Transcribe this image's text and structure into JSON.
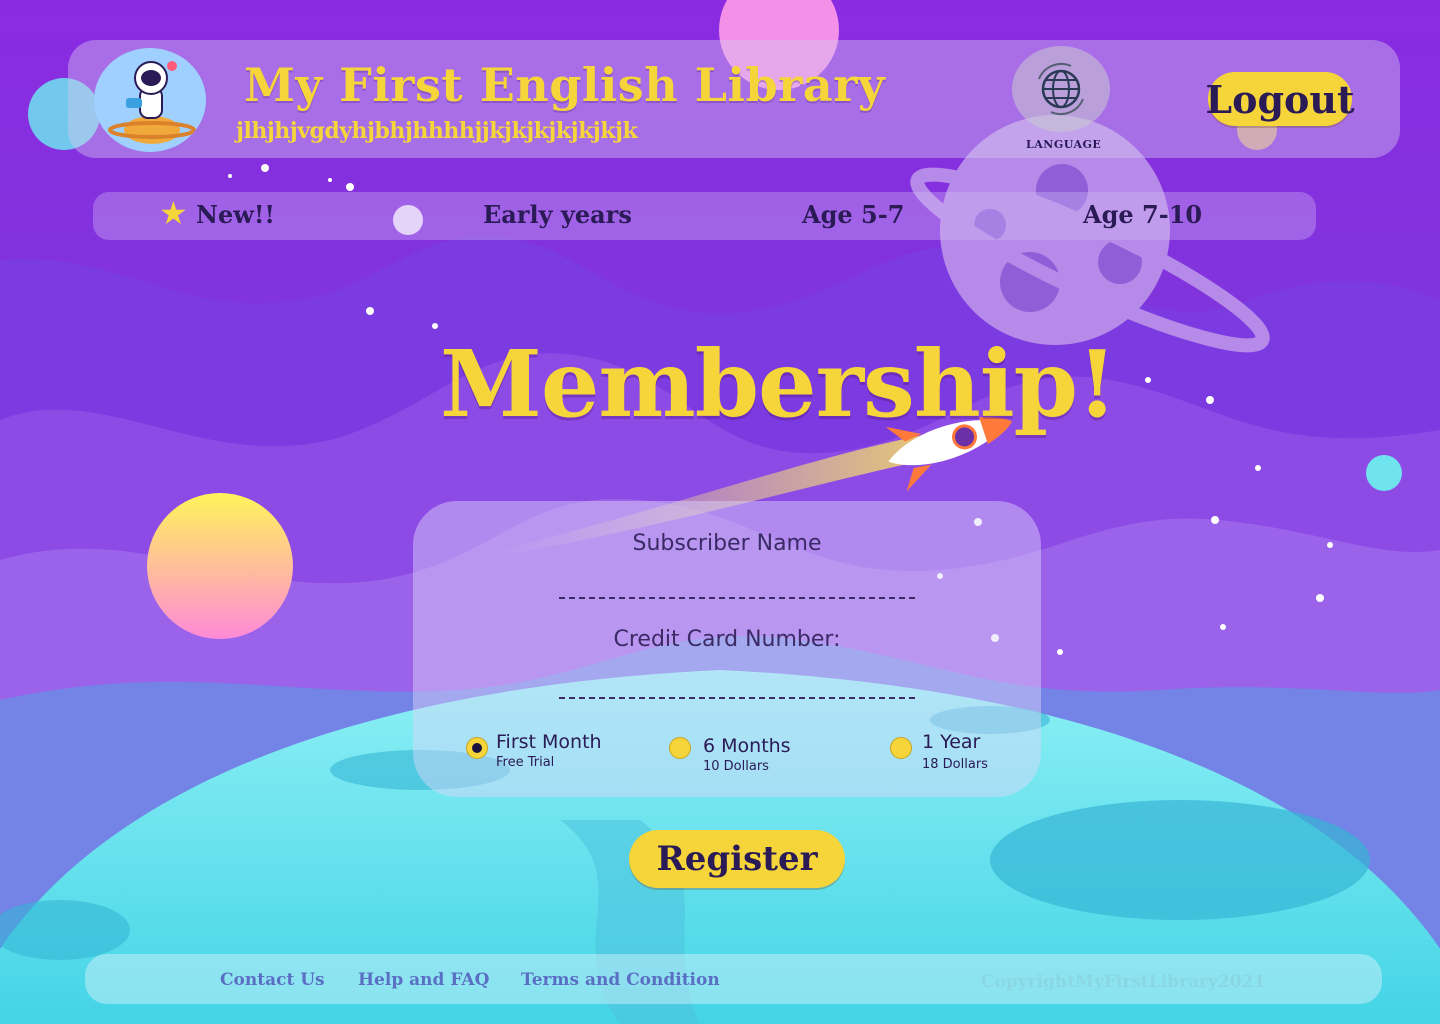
{
  "header": {
    "title": "My First English Library",
    "subtitle": "jlhjhjvgdyhjbhjhhhhjjkjkjkjkjkjkjk",
    "language_label": "LANGUAGE",
    "logout_label": "Logout"
  },
  "nav": {
    "items": [
      {
        "label": "New!!"
      },
      {
        "label": "Early years"
      },
      {
        "label": "Age 5-7"
      },
      {
        "label": "Age 7-10"
      }
    ]
  },
  "main": {
    "title": "Membership!",
    "form": {
      "name_label": "Subscriber Name",
      "name_value": "",
      "card_label": "Credit Card Number:",
      "card_value": "",
      "plans": [
        {
          "name": "First Month",
          "desc": "Free Trial",
          "selected": true
        },
        {
          "name": "6 Months",
          "desc": "10 Dollars",
          "selected": false
        },
        {
          "name": "1 Year",
          "desc": "18 Dollars",
          "selected": false
        }
      ]
    },
    "register_label": "Register"
  },
  "footer": {
    "links": [
      "Contact Us",
      "Help and FAQ",
      "Terms and Condition"
    ],
    "copyright": "CopyrightMyFirstLibrary2021"
  },
  "colors": {
    "accent": "#f5d53a",
    "text_dark": "#2a1a55",
    "sky": "#7a2fd6",
    "planet": "#6fe3ee"
  },
  "icons": {
    "logo": "astronaut-on-planet-icon",
    "language": "globe-icon",
    "new": "star-icon"
  }
}
